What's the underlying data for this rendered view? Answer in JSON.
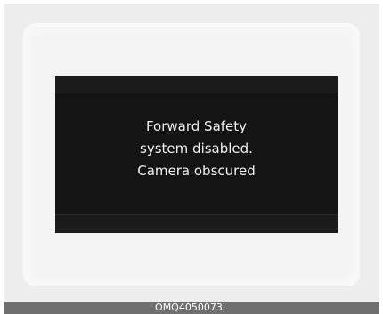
{
  "display": {
    "message_lines": [
      "Forward Safety",
      "system disabled.",
      "Camera obscured"
    ]
  },
  "caption": {
    "code": "OMQ4050073L"
  },
  "colors": {
    "display_background": "#141414",
    "text": "#f0f0f0",
    "caption_bar": "#6f6f6f"
  }
}
